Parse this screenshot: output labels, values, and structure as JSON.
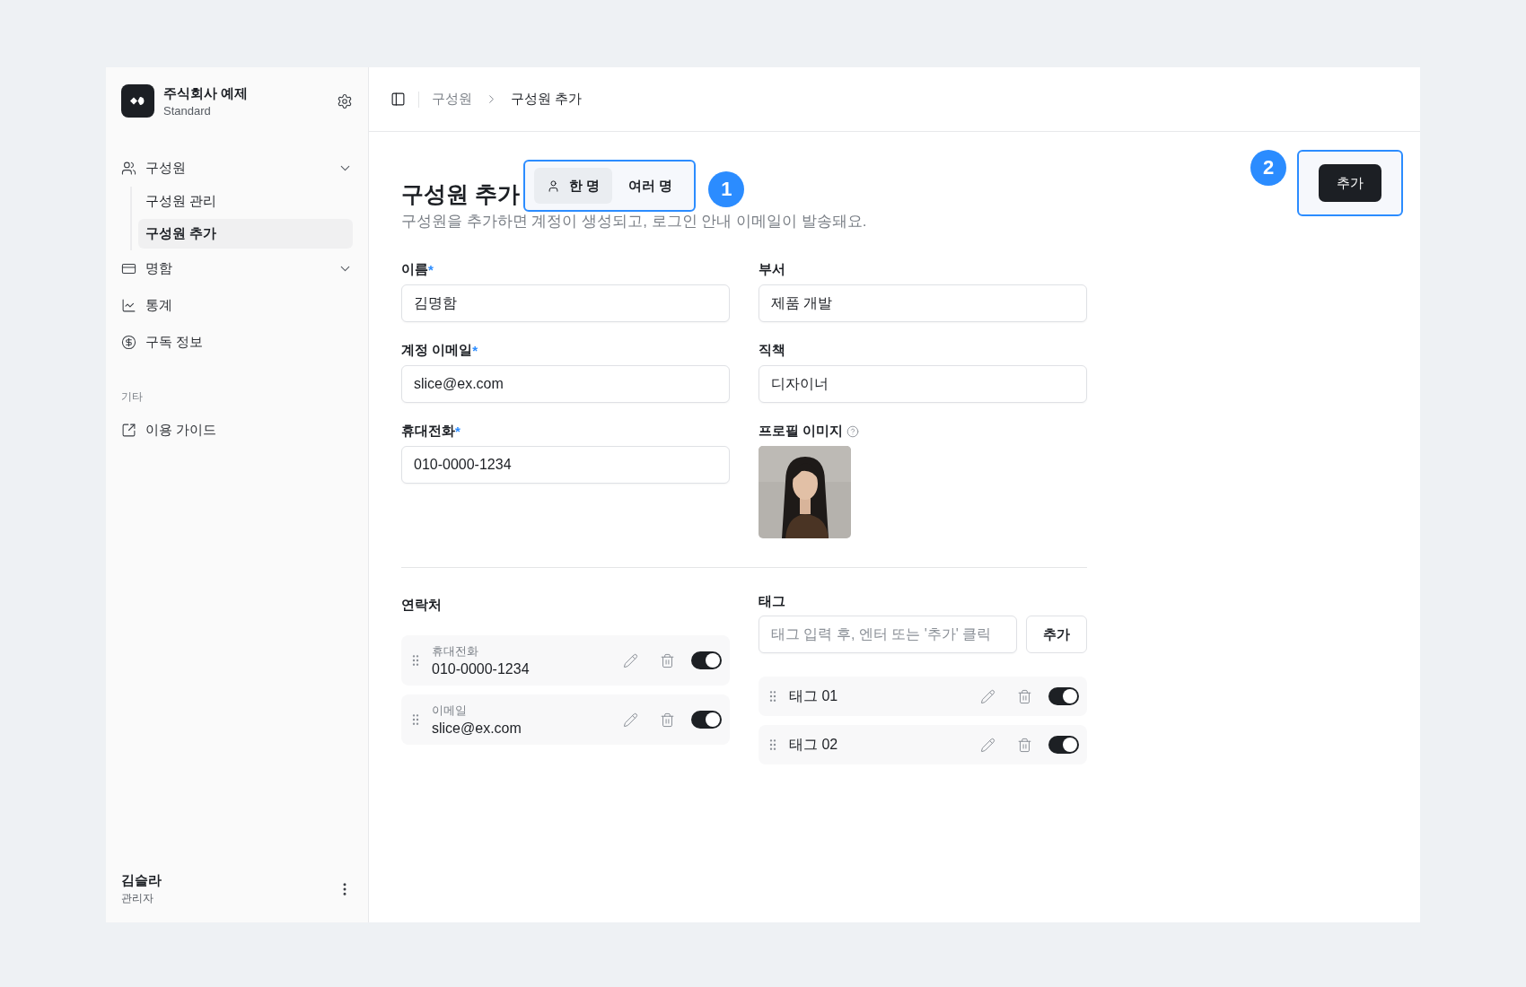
{
  "sidebar": {
    "org": {
      "name": "주식회사 예제",
      "plan": "Standard"
    },
    "nav": [
      {
        "label": "구성원",
        "expandable": true,
        "children": [
          {
            "label": "구성원 관리",
            "selected": false
          },
          {
            "label": "구성원 추가",
            "selected": true
          }
        ]
      },
      {
        "label": "명함",
        "expandable": true
      },
      {
        "label": "통계",
        "expandable": false
      },
      {
        "label": "구독 정보",
        "expandable": false
      }
    ],
    "section_label": "기타",
    "links": [
      {
        "label": "이용 가이드"
      }
    ],
    "user": {
      "name": "김슬라",
      "role": "관리자"
    }
  },
  "header": {
    "breadcrumb": [
      {
        "label": "구성원",
        "current": false
      },
      {
        "label": "구성원 추가",
        "current": true
      }
    ]
  },
  "page": {
    "title": "구성원 추가",
    "mode_tabs": [
      {
        "label": "한 명",
        "selected": true
      },
      {
        "label": "여러 명",
        "selected": false
      }
    ],
    "callouts": [
      "1",
      "2"
    ],
    "primary_button": "추가",
    "description": "구성원을 추가하면 계정이 생성되고, 로그인 안내 이메일이 발송돼요."
  },
  "form": {
    "fields": [
      {
        "kind": "text",
        "label": "이름",
        "required_mark": "*",
        "value": "김명함"
      },
      {
        "kind": "text",
        "label": "부서",
        "value": "제품 개발"
      },
      {
        "kind": "text",
        "label": "계정 이메일",
        "required_mark": "*",
        "value": "slice@ex.com"
      },
      {
        "kind": "text",
        "label": "직책",
        "value": "디자이너"
      },
      {
        "kind": "text",
        "label": "휴대전화",
        "required_mark": "*",
        "value": "010-0000-1234"
      },
      {
        "label": "프로필 이미지",
        "help": true
      }
    ]
  },
  "contacts": {
    "title": "연락처",
    "items": [
      {
        "label": "휴대전화",
        "value": "010-0000-1234",
        "on": true
      },
      {
        "label": "이메일",
        "value": "slice@ex.com",
        "on": true
      }
    ]
  },
  "tags": {
    "title": "태그",
    "input": {
      "placeholder": "태그 입력 후, 엔터 또는 '추가' 클릭"
    },
    "add_button": "추가",
    "items": [
      {
        "label": "태그 01",
        "on": true
      },
      {
        "label": "태그 02",
        "on": true
      }
    ]
  }
}
